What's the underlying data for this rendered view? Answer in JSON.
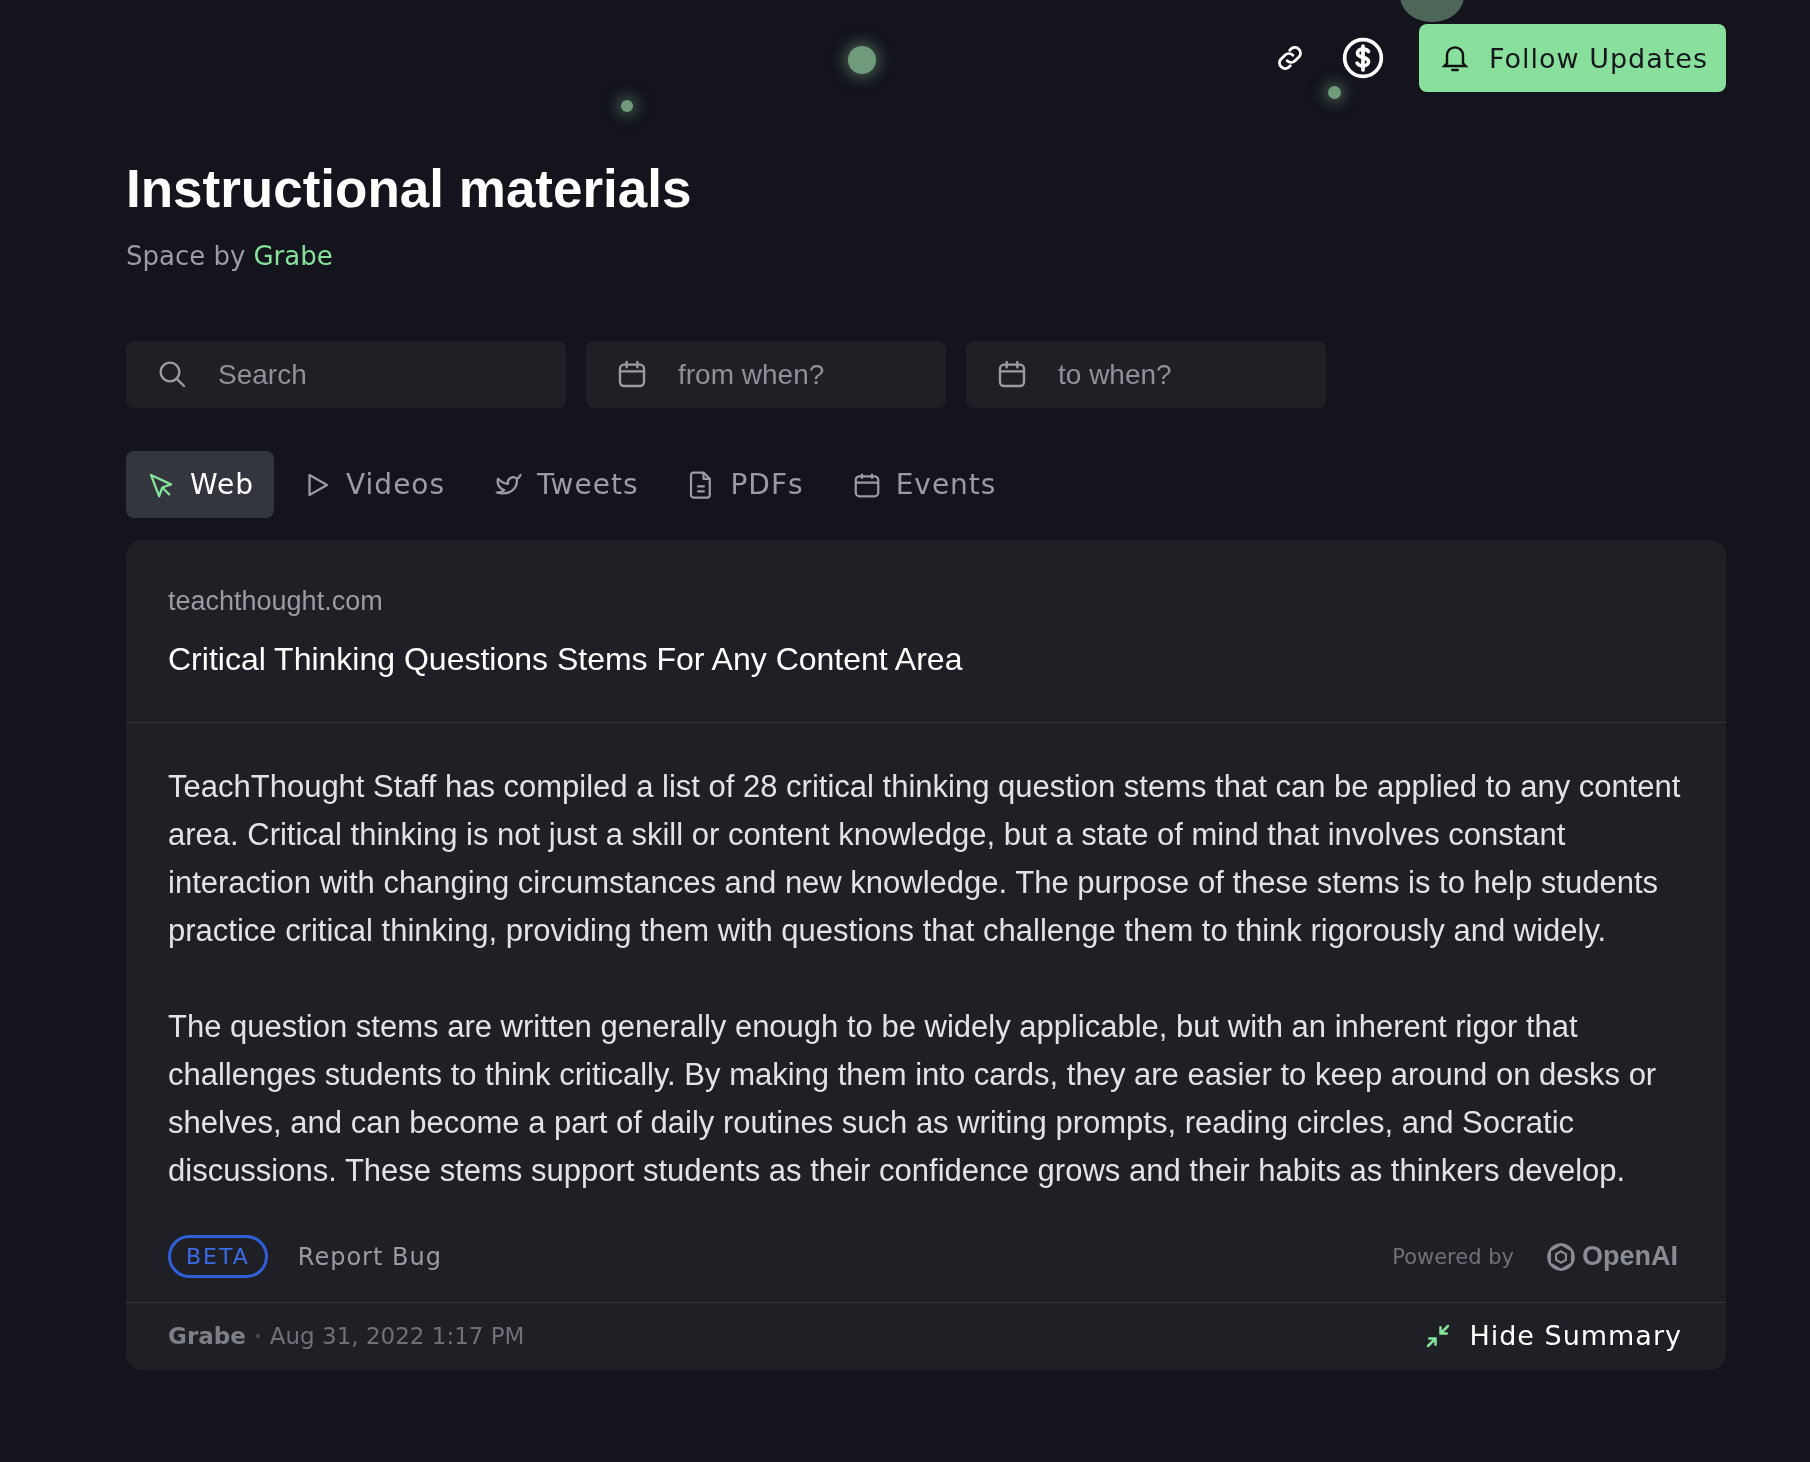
{
  "header": {
    "follow_button": "Follow Updates"
  },
  "space": {
    "title": "Instructional materials",
    "byline": "Space by",
    "owner": "Grabe"
  },
  "filters": [
    {
      "kind": "search",
      "placeholder": "Search"
    },
    {
      "kind": "date",
      "placeholder": "from when?"
    },
    {
      "kind": "date",
      "placeholder": "to when?"
    }
  ],
  "tabs": [
    {
      "kind": "web",
      "label": "Web",
      "selected": true
    },
    {
      "kind": "video",
      "label": "Videos",
      "selected": false
    },
    {
      "kind": "tweet",
      "label": "Tweets",
      "selected": false
    },
    {
      "kind": "pdf",
      "label": "PDFs",
      "selected": false
    },
    {
      "kind": "event",
      "label": "Events",
      "selected": false
    }
  ],
  "card": {
    "domain": "teachthought.com",
    "title": "Critical Thinking Questions Stems For Any Content Area",
    "paragraphs": [
      "TeachThought Staff has compiled a list of 28 critical thinking question stems that can be applied to any content area. Critical thinking is not just a skill or content knowledge, but a state of mind that involves constant interaction with changing circumstances and new knowledge. The purpose of these stems is to help students practice critical thinking, providing them with questions that challenge them to think rigorously and widely.",
      "The question stems are written generally enough to be widely applicable, but with an inherent rigor that challenges students to think critically. By making them into cards, they are easier to keep around on desks or shelves, and can become a part of daily routines such as writing prompts, reading circles, and Socratic discussions. These stems support students as their confidence grows and their habits as thinkers develop."
    ],
    "badge": "BETA",
    "report": "Report Bug",
    "powered_by": "Powered by",
    "provider": "OpenAI",
    "author": "Grabe",
    "date": "Aug 31, 2022 1:17 PM",
    "toggle": "Hide Summary"
  }
}
